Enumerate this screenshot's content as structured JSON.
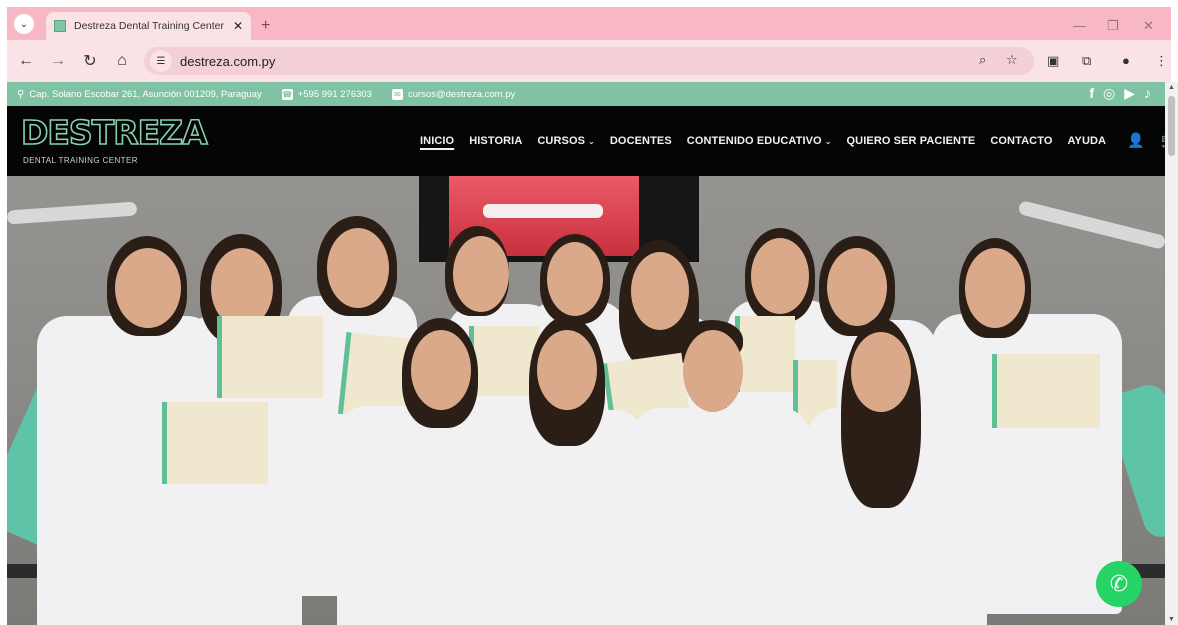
{
  "browser": {
    "tab_title": "Destreza Dental Training Center - ",
    "url": "destreza.com.py"
  },
  "topbar": {
    "address": "Cap. Solano Escobar 261, Asunción 001209, Paraguay",
    "phone": "+595 991 276303",
    "email": "cursos@destreza.com.py"
  },
  "header": {
    "logo_main": "DESTREZA",
    "logo_sub": "DENTAL TRAINING CENTER",
    "menu": [
      {
        "label": "INICIO",
        "dropdown": false
      },
      {
        "label": "HISTORIA",
        "dropdown": false
      },
      {
        "label": "CURSOS",
        "dropdown": true
      },
      {
        "label": "DOCENTES",
        "dropdown": false
      },
      {
        "label": "CONTENIDO EDUCATIVO",
        "dropdown": true
      },
      {
        "label": "QUIERO SER PACIENTE",
        "dropdown": false
      },
      {
        "label": "CONTACTO",
        "dropdown": false
      },
      {
        "label": "AYUDA",
        "dropdown": false
      }
    ]
  },
  "colors": {
    "brand_green": "#7fc3a4",
    "header_bg": "#050505",
    "whatsapp": "#25d366"
  }
}
